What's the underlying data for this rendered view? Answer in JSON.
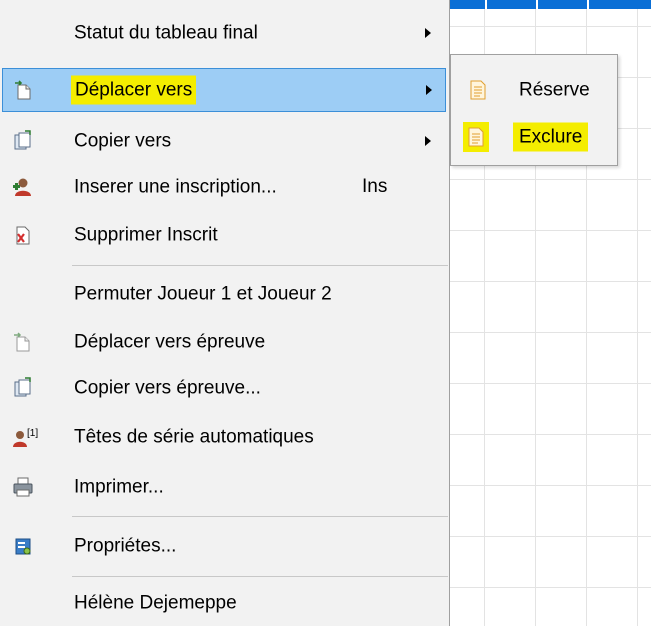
{
  "menu": {
    "items": [
      {
        "label": "Statut du tableau final",
        "icon": "none",
        "has_submenu": true
      },
      {
        "label": "Déplacer vers",
        "icon": "move-page-icon",
        "has_submenu": true,
        "highlighted": true
      },
      {
        "label": "Copier vers",
        "icon": "copy-page-icon",
        "has_submenu": true
      },
      {
        "label": "Inserer une inscription...",
        "icon": "add-user-icon",
        "shortcut": "Ins"
      },
      {
        "label": "Supprimer Inscrit",
        "icon": "delete-page-icon"
      },
      {
        "label": "Permuter Joueur 1 et Joueur 2",
        "icon": "none"
      },
      {
        "label": "Déplacer vers épreuve",
        "icon": "move-page-icon"
      },
      {
        "label": "Copier vers épreuve...",
        "icon": "copy-page-icon"
      },
      {
        "label": "Têtes de série automatiques",
        "icon": "seed-user-icon",
        "icon_badge": "[1]"
      },
      {
        "label": "Imprimer...",
        "icon": "printer-icon"
      },
      {
        "label": "Propriétes...",
        "icon": "properties-icon"
      },
      {
        "label": "Hélène Dejemeppe",
        "icon": "none"
      }
    ]
  },
  "submenu": {
    "items": [
      {
        "label": "Réserve",
        "icon": "document-icon"
      },
      {
        "label": "Exclure",
        "icon": "document-icon",
        "highlighted": true
      }
    ]
  },
  "colors": {
    "menu_bg": "#f2f2f2",
    "highlight_bg": "#9dcdf5",
    "highlight_border": "#3c8fd8",
    "yellow_mark": "#f4ed00",
    "grid_top_bar": "#0a6fd6"
  }
}
